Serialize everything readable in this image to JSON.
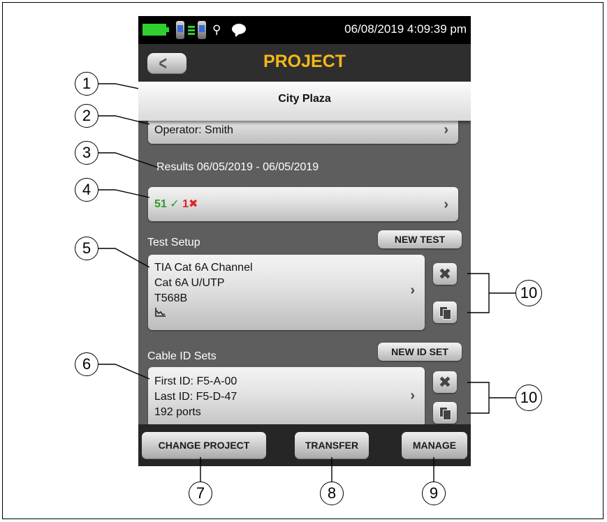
{
  "status_bar": {
    "datetime": "06/08/2019 4:09:39 pm",
    "icons": [
      "battery-icon",
      "remote-connected-icon",
      "link-icon",
      "remote-connected-icon",
      "location-icon",
      "message-icon"
    ]
  },
  "header": {
    "title": "PROJECT",
    "back_icon": "back-chevron-icon"
  },
  "project": {
    "name": "City Plaza"
  },
  "operator": {
    "label": "Operator: Smith"
  },
  "results": {
    "label": "Results",
    "date_range": "06/05/2019 - 06/05/2019",
    "pass_count": "51",
    "fail_count": "1",
    "pass_icon": "✓",
    "fail_icon": "✖"
  },
  "test_setup": {
    "label": "Test Setup",
    "new_button": "NEW TEST",
    "lines": [
      "TIA Cat 6A Channel",
      "Cat 6A U/UTP",
      "T568B"
    ],
    "graph_icon": "graph-icon"
  },
  "cable_id_sets": {
    "label": "Cable ID Sets",
    "new_button": "NEW ID SET",
    "lines": [
      "First ID: F5-A-00",
      "Last ID: F5-D-47",
      "192 ports"
    ]
  },
  "bottom_bar": {
    "change_project": "CHANGE PROJECT",
    "transfer": "TRANSFER",
    "manage": "MANAGE"
  },
  "callouts": {
    "c1": "1",
    "c2": "2",
    "c3": "3",
    "c4": "4",
    "c5": "5",
    "c6": "6",
    "c7": "7",
    "c8": "8",
    "c9": "9",
    "c10a": "10",
    "c10b": "10"
  },
  "colors": {
    "title": "#f5b71b",
    "pass": "#2a9d2a",
    "fail": "#e02323",
    "battery": "#2fcf2f"
  }
}
